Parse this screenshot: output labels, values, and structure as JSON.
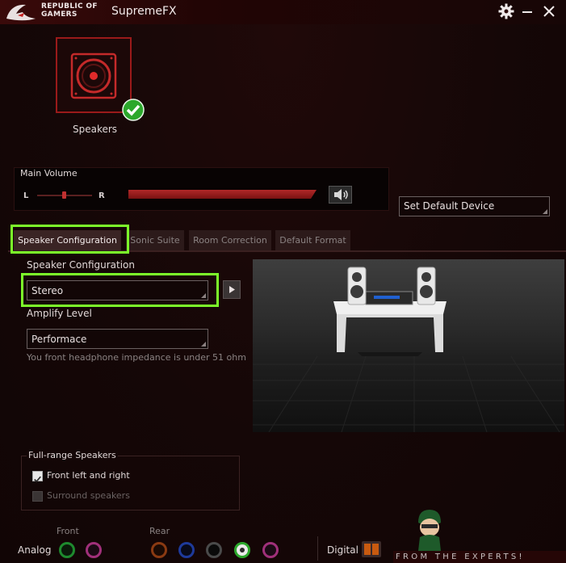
{
  "titlebar": {
    "brand_line1": "REPUBLIC OF",
    "brand_line2": "GAMERS",
    "app_title": "SupremeFX",
    "icons": [
      "rog-logo-icon",
      "gear-icon",
      "minimize-icon",
      "close-icon"
    ]
  },
  "device": {
    "label": "Speakers",
    "status_icon": "check-icon",
    "accent": "#c4262a",
    "status_color": "#2ca82c"
  },
  "volume": {
    "title": "Main Volume",
    "left_label": "L",
    "right_label": "R",
    "balance": 0.5,
    "level": 1.0,
    "mute_icon": "speaker-volume-icon"
  },
  "default_device": {
    "label": "Set Default Device"
  },
  "tabs": [
    {
      "label": "Speaker Configuration",
      "active": true
    },
    {
      "label": "Sonic Suite",
      "active": false
    },
    {
      "label": "Room Correction",
      "active": false
    },
    {
      "label": "Default Format",
      "active": false
    }
  ],
  "speaker_config": {
    "label": "Speaker Configuration",
    "value": "Stereo",
    "play_icon": "play-icon"
  },
  "amplify": {
    "label": "Amplify Level",
    "value": "Performace",
    "hint": "You front headphone impedance is under 51 ohm"
  },
  "full_range": {
    "title": "Full-range Speakers",
    "options": [
      {
        "label": "Front left and right",
        "checked": true,
        "enabled": true
      },
      {
        "label": "Surround speakers",
        "checked": false,
        "enabled": false
      }
    ]
  },
  "jacks": {
    "analog_label": "Analog",
    "front_label": "Front",
    "rear_label": "Rear",
    "digital_label": "Digital",
    "front_colors": [
      "#1e8a2e",
      "#a0307a"
    ],
    "rear_colors": [
      "#8a3a12",
      "#1e3a9a",
      "#2a2a2a",
      "#1e8a2e",
      "#a0307a"
    ]
  },
  "watermark": {
    "text": "FROM THE EXPERTS!"
  },
  "highlight_color": "#7cff2a"
}
